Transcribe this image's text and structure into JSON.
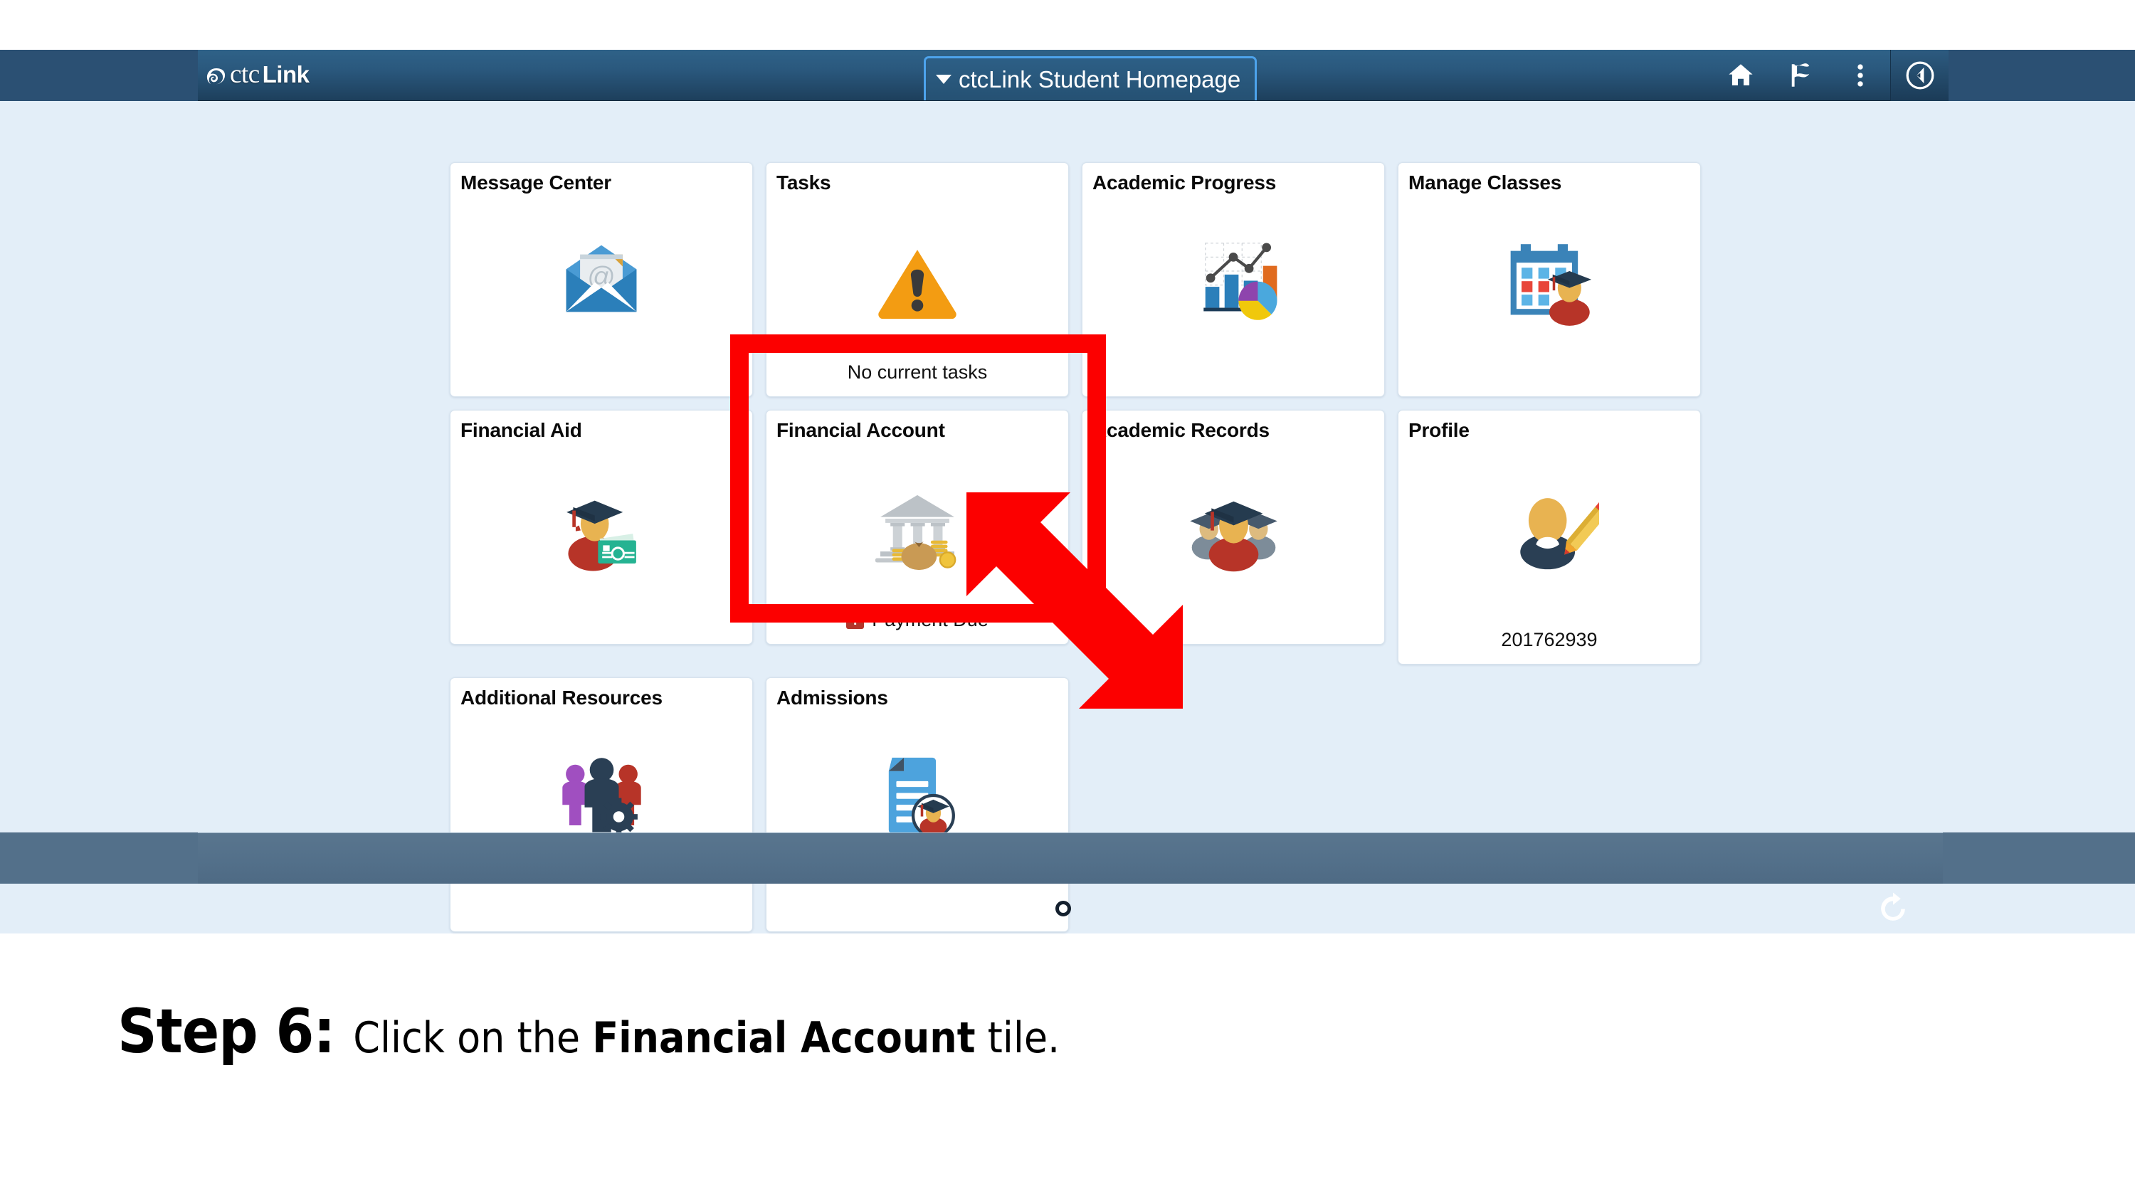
{
  "app": {
    "brand_mark": "ctcLink",
    "brand_prefix": "ctc",
    "brand_suffix": "Link",
    "page_title": "ctcLink Student Homepage"
  },
  "header": {
    "icons": [
      {
        "name": "home-icon",
        "label": "Home"
      },
      {
        "name": "flag-icon",
        "label": "Notifications"
      },
      {
        "name": "actions-menu-icon",
        "label": "Actions"
      },
      {
        "name": "navbar-compass-icon",
        "label": "NavBar"
      }
    ]
  },
  "tiles": [
    {
      "title": "Message Center",
      "icon": "envelope-at-icon",
      "footer": "",
      "badge": false
    },
    {
      "title": "Tasks",
      "icon": "warning-triangle-icon",
      "footer": "No current tasks",
      "badge": false
    },
    {
      "title": "Academic Progress",
      "icon": "charts-icon",
      "footer": "",
      "badge": false
    },
    {
      "title": "Manage Classes",
      "icon": "calendar-student-icon",
      "footer": "",
      "badge": false
    },
    {
      "title": "Financial Aid",
      "icon": "student-money-icon",
      "footer": "",
      "badge": false
    },
    {
      "title": "Financial Account",
      "icon": "bank-moneybag-icon",
      "footer": "Payment Due",
      "badge": true,
      "badge_glyph": "!"
    },
    {
      "title": "Academic Records",
      "icon": "students-group-icon",
      "footer": "",
      "badge": false
    },
    {
      "title": "Profile",
      "icon": "person-pencil-icon",
      "footer": "201762939",
      "badge": false
    },
    {
      "title": "Additional Resources",
      "icon": "people-gear-icon",
      "footer": "",
      "badge": false
    },
    {
      "title": "Admissions",
      "icon": "document-student-icon",
      "footer": "",
      "badge": false
    }
  ],
  "bottom_bar": {
    "page_dot": "●",
    "refresh": "refresh-icon"
  },
  "annotation": {
    "highlight_target": "Financial Account",
    "highlight_color": "#fc0000",
    "arrow_color": "#fc0000"
  },
  "caption": {
    "step": "Step 6:",
    "text_before": "Click on the ",
    "emphasis": "Financial Account",
    "text_after": " tile."
  }
}
